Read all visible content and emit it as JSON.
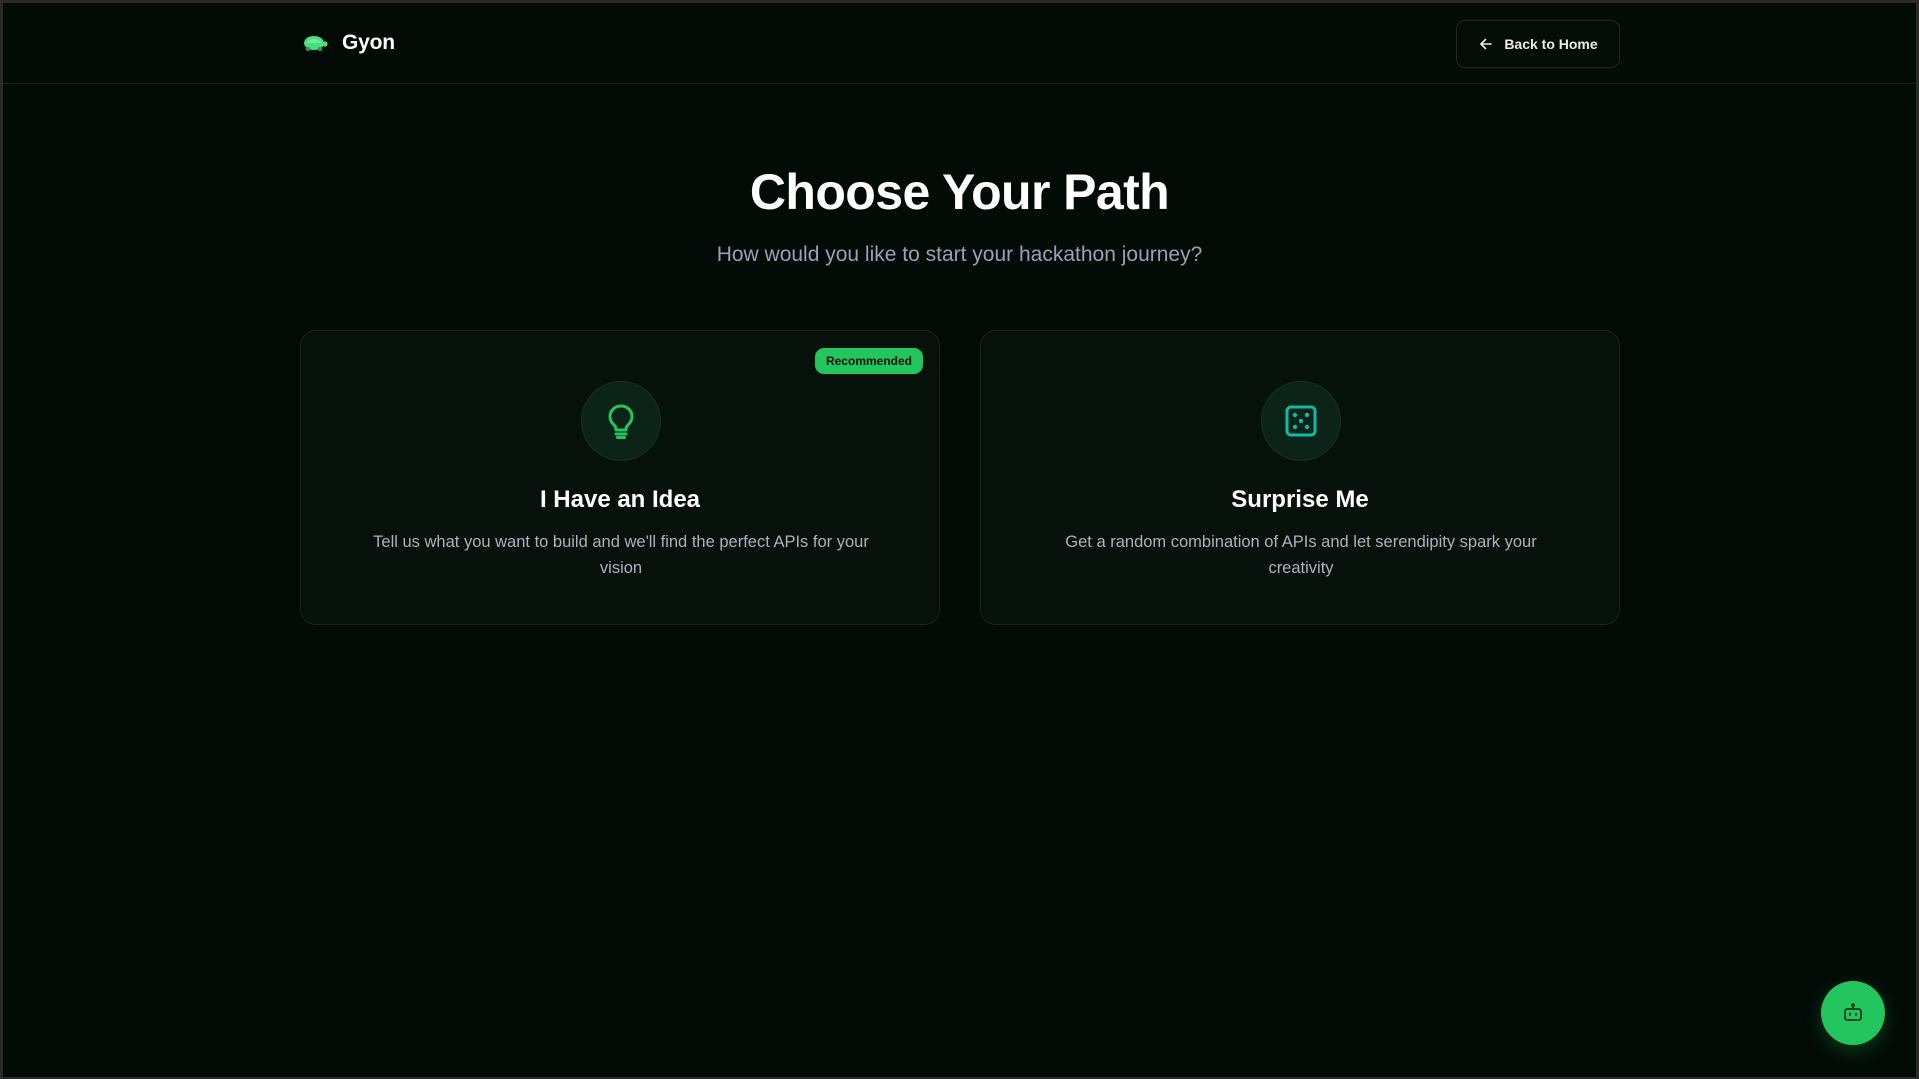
{
  "header": {
    "brand_name": "Gyon",
    "back_label": "Back to Home"
  },
  "hero": {
    "title": "Choose Your Path",
    "subtitle": "How would you like to start your hackathon journey?"
  },
  "options": [
    {
      "badge": "Recommended",
      "title": "I Have an Idea",
      "description": "Tell us what you want to build and we'll find the perfect APIs for your vision",
      "icon": "lightbulb-icon"
    },
    {
      "title": "Surprise Me",
      "description": "Get a random combination of APIs and let serendipity spark your creativity",
      "icon": "dice-icon"
    }
  ],
  "chat": {
    "icon": "bot-icon"
  },
  "colors": {
    "accent": "#22c55e",
    "background": "#030b07",
    "teal": "#14b8a6"
  }
}
